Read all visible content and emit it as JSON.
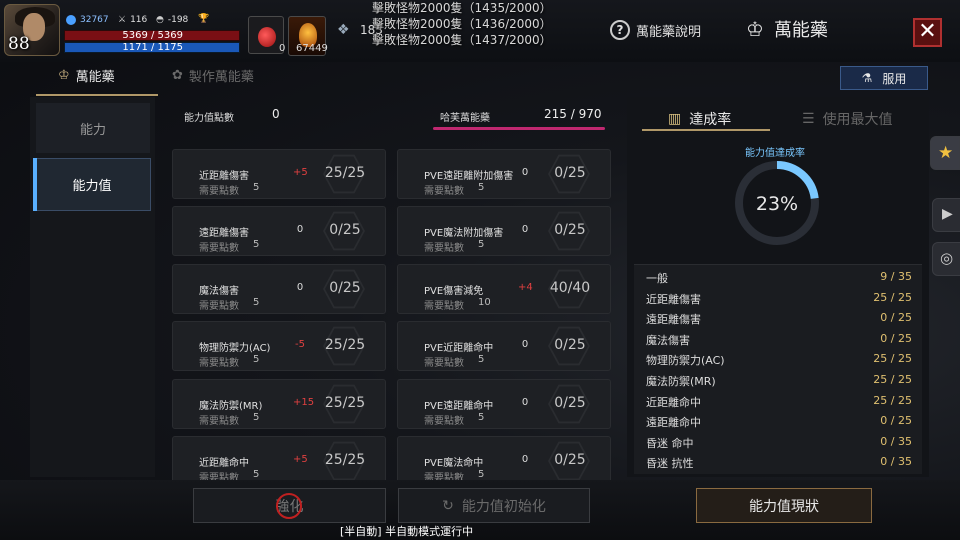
{
  "player": {
    "level": "88",
    "power": "32767",
    "stat_a": "116",
    "stat_b": "-198",
    "hp": "5369 / 5369",
    "mp": "1171 / 1175"
  },
  "items": {
    "potion_count": "0",
    "potion2_count": "67449",
    "resource_count": "183"
  },
  "quests": [
    "擊敗怪物2000隻（1435/2000）",
    "擊敗怪物2000隻（1436/2000）",
    "擊敗怪物2000隻（1437/2000）"
  ],
  "header": {
    "help_label": "萬能藥說明",
    "title": "萬能藥",
    "close_icon": "close-icon"
  },
  "tabs": {
    "tab1": "萬能藥",
    "tab2": "製作萬能藥",
    "use_button": "服用"
  },
  "menu": {
    "item1": "能力",
    "item2": "能力值"
  },
  "points": {
    "label": "能力值點數",
    "value": "0",
    "potion_label": "哈芙萬能藥",
    "potion_value": "215 / 970"
  },
  "cards": [
    {
      "name": "近距離傷害",
      "req_label": "需要點數",
      "req": "5",
      "bonus": "+5",
      "progress": "25/25"
    },
    {
      "name": "PVE遠距離附加傷害",
      "req_label": "需要點數",
      "req": "5",
      "bonus": "0",
      "progress": "0/25"
    },
    {
      "name": "遠距離傷害",
      "req_label": "需要點數",
      "req": "5",
      "bonus": "0",
      "progress": "0/25"
    },
    {
      "name": "PVE魔法附加傷害",
      "req_label": "需要點數",
      "req": "5",
      "bonus": "0",
      "progress": "0/25"
    },
    {
      "name": "魔法傷害",
      "req_label": "需要點數",
      "req": "5",
      "bonus": "0",
      "progress": "0/25"
    },
    {
      "name": "PVE傷害減免",
      "req_label": "需要點數",
      "req": "10",
      "bonus": "+4",
      "progress": "40/40"
    },
    {
      "name": "物理防禦力(AC)",
      "req_label": "需要點數",
      "req": "5",
      "bonus": "-5",
      "progress": "25/25"
    },
    {
      "name": "PVE近距離命中",
      "req_label": "需要點數",
      "req": "5",
      "bonus": "0",
      "progress": "0/25"
    },
    {
      "name": "魔法防禦(MR)",
      "req_label": "需要點數",
      "req": "5",
      "bonus": "+15",
      "progress": "25/25"
    },
    {
      "name": "PVE遠距離命中",
      "req_label": "需要點數",
      "req": "5",
      "bonus": "0",
      "progress": "0/25"
    },
    {
      "name": "近距離命中",
      "req_label": "需要點數",
      "req": "5",
      "bonus": "+5",
      "progress": "25/25"
    },
    {
      "name": "PVE魔法命中",
      "req_label": "需要點數",
      "req": "5",
      "bonus": "0",
      "progress": "0/25"
    }
  ],
  "right": {
    "tab1": "達成率",
    "tab2": "使用最大值",
    "rate_label": "能力值達成率",
    "rate_pct": "23%",
    "rate_value": 0.23
  },
  "summary": [
    {
      "label": "一般",
      "value": "9 / 35"
    },
    {
      "label": "近距離傷害",
      "value": "25 / 25"
    },
    {
      "label": "遠距離傷害",
      "value": "0 / 25"
    },
    {
      "label": "魔法傷害",
      "value": "0 / 25"
    },
    {
      "label": "物理防禦力(AC)",
      "value": "25 / 25"
    },
    {
      "label": "魔法防禦(MR)",
      "value": "25 / 25"
    },
    {
      "label": "近距離命中",
      "value": "25 / 25"
    },
    {
      "label": "遠距離命中",
      "value": "0 / 25"
    },
    {
      "label": "昏迷 命中",
      "value": "0 / 35"
    },
    {
      "label": "昏迷 抗性",
      "value": "0 / 35"
    }
  ],
  "bottom": {
    "btn1": "強化",
    "btn2": "能力值初始化",
    "btn3": "能力值現狀",
    "auto_msg": "[半自動] 半自動模式運行中"
  },
  "colors": {
    "accent": "#b09868",
    "hp": "#7a0f14",
    "mp": "#1a58b8",
    "ring": "#7ac8ff",
    "bonus_red": "#e04040",
    "value_gold": "#e0c070"
  }
}
